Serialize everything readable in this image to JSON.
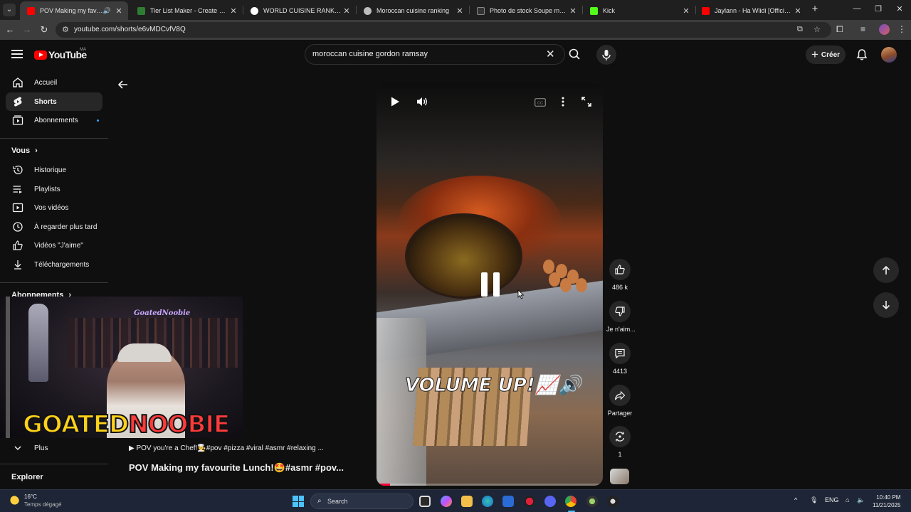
{
  "browser": {
    "tabs": [
      {
        "title": "POV Making my favourite L",
        "active": true,
        "favicon_color": "#ff0000",
        "audio": true
      },
      {
        "title": "Tier List Maker - Create a Tier L",
        "active": false,
        "favicon_color": "#2e7d32"
      },
      {
        "title": "WORLD CUISINE RANK - Reche",
        "active": false,
        "favicon_color": "#ffffff"
      },
      {
        "title": "Moroccan cuisine ranking",
        "active": false,
        "favicon_color": "#bdbdbd"
      },
      {
        "title": "Photo de stock Soupe marocai",
        "active": false,
        "favicon_color": "#333333"
      },
      {
        "title": "Kick",
        "active": false,
        "favicon_color": "#53fc18"
      },
      {
        "title": "Jaylann - Ha Wlidi [Official Mu",
        "active": false,
        "favicon_color": "#ff0000"
      }
    ],
    "url": "youtube.com/shorts/e6vMDCvfV8Q"
  },
  "header": {
    "logo_text": "YouTube",
    "country_code": "MA",
    "search_query": "moroccan cuisine gordon ramsay",
    "create_label": "Créer"
  },
  "sidebar": {
    "items": [
      {
        "label": "Accueil",
        "icon": "home-icon"
      },
      {
        "label": "Shorts",
        "icon": "shorts-icon",
        "active": true
      },
      {
        "label": "Abonnements",
        "icon": "subscriptions-icon",
        "badge": true
      }
    ],
    "you_heading": "Vous",
    "you_items": [
      {
        "label": "Historique",
        "icon": "history-icon"
      },
      {
        "label": "Playlists",
        "icon": "playlists-icon"
      },
      {
        "label": "Vos vidéos",
        "icon": "your-videos-icon"
      },
      {
        "label": "À regarder plus tard",
        "icon": "watch-later-icon"
      },
      {
        "label": "Vidéos \"J'aime\"",
        "icon": "liked-videos-icon"
      },
      {
        "label": "Téléchargements",
        "icon": "downloads-icon"
      }
    ],
    "subs_heading": "Abonnements",
    "more_label": "Plus",
    "explore_heading": "Explorer"
  },
  "webcam": {
    "channel_logo_text": "GoatedNoobie",
    "overlay_brand_a": "GOATED",
    "overlay_brand_b": "NOOBIE"
  },
  "short": {
    "caption": "VOLUME UP!📈🔊",
    "description": "▶ POV you're a Chef!🧑‍🍳#pov #pizza #viral #asmr #relaxing ...",
    "title": "POV Making my favourite Lunch!🤩#asmr #pov...",
    "progress": 0.06,
    "likes": "486 k",
    "dislike_label": "Je n'aim...",
    "comments": "4413",
    "share_label": "Partager",
    "remix_count": "1"
  },
  "taskbar": {
    "temp": "16°C",
    "weather": "Temps dégagé",
    "search_placeholder": "Search",
    "lang": "ENG",
    "time": "10:40 PM",
    "date": "11/21/2025"
  }
}
